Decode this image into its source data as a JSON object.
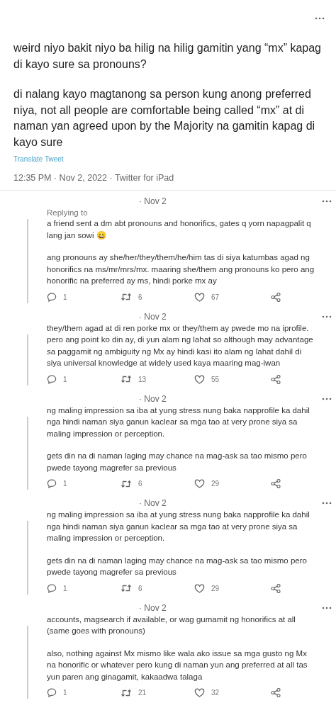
{
  "tweet": {
    "paragraphs": [
      "weird niyo bakit niyo ba hilig na hilig gamitin yang “mx” kapag di kayo sure sa pronouns?",
      "di nalang kayo magtanong sa person kung anong preferred niya, not all people are comfortable being called “mx” at di naman yan agreed upon by the Majority na gamitin kapag di kayo sure"
    ],
    "translate": "Translate Tweet",
    "meta": "12:35 PM · Nov 2, 2022 · Twitter for iPad"
  },
  "replies": [
    {
      "date": "· Nov 2",
      "replying_to": "Replying to",
      "paragraphs": [
        "a friend sent a dm abt pronouns and honorifics, gates q yorn napagpalit q lang jan sowi 😀",
        "ang pronouns ay she/her/they/them/he/him tas di siya katumbas agad ng honorifics na ms/mr/mrs/mx. maaring she/them ang pronouns ko pero ang honorific na preferred ay ms, hindi porke mx ay"
      ],
      "replies": "1",
      "retweets": "6",
      "likes": "67"
    },
    {
      "date": "· Nov 2",
      "paragraphs": [
        "they/them agad at di ren porke mx or they/them ay pwede mo na iprofile. pero ang point ko din ay, di yun alam ng lahat so although may advantage sa paggamit ng ambiguity ng Mx ay hindi kasi ito alam ng lahat dahil di siya universal knowledge at widely used kaya maaring mag-iwan"
      ],
      "replies": "1",
      "retweets": "13",
      "likes": "55"
    },
    {
      "date": "· Nov 2",
      "paragraphs": [
        "ng maling impression sa iba at yung stress nung baka napprofile ka dahil nga hindi naman siya ganun kaclear sa mga tao at very prone siya sa maling impression or perception.",
        "gets din na di naman laging may chance na mag-ask sa tao mismo pero pwede tayong magrefer sa previous"
      ],
      "replies": "1",
      "retweets": "6",
      "likes": "29"
    },
    {
      "date": "· Nov 2",
      "paragraphs": [
        "ng maling impression sa iba at yung stress nung baka napprofile ka dahil nga hindi naman siya ganun kaclear sa mga tao at very prone siya sa maling impression or perception.",
        "gets din na di naman laging may chance na mag-ask sa tao mismo pero pwede tayong magrefer sa previous"
      ],
      "replies": "1",
      "retweets": "6",
      "likes": "29"
    },
    {
      "date": "· Nov 2",
      "paragraphs": [
        "accounts, magsearch if available, or wag gumamit ng honorifics at all (same goes with pronouns)",
        "also, nothing against Mx mismo like wala ako issue sa mga gusto ng Mx na honorific or whatever pero kung di naman yun ang preferred at all tas yun paren ang ginagamit, kakaadwa talaga"
      ],
      "replies": "1",
      "retweets": "21",
      "likes": "32"
    }
  ]
}
